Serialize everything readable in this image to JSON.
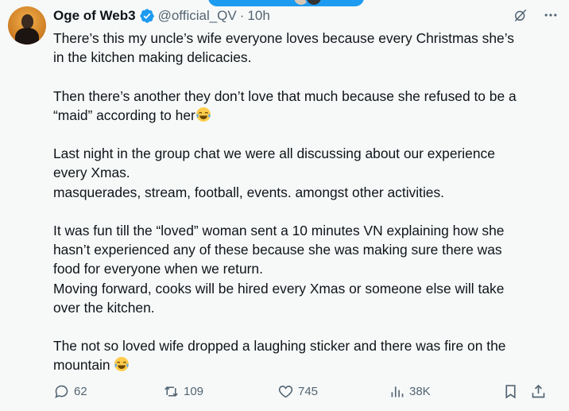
{
  "author": {
    "display_name": "Oge of Web3",
    "handle": "@official_QV",
    "separator": "·",
    "time": "10h"
  },
  "icons": {
    "verified": "verified-badge-icon",
    "grok": "grok-icon",
    "more": "more-horizontal-icon",
    "reply": "reply-icon",
    "retweet": "retweet-icon",
    "like": "like-icon",
    "views": "views-icon",
    "bookmark": "bookmark-icon",
    "share": "share-icon",
    "emoji": "face-with-tears-of-joy-emoji"
  },
  "colors": {
    "accent": "#1d9bf0",
    "text": "#0f1419",
    "secondary": "#536471",
    "background": "#f7f9f9"
  },
  "body": {
    "p1_l1": "There’s this my uncle’s wife everyone loves because every Christmas she’s",
    "p1_l2": "in the kitchen making delicacies.",
    "p2_l1": "Then there’s another they don’t love that much because she refused to be a",
    "p2_l2": "“maid” according to her",
    "p3_l1": "Last night in the group chat we were all discussing about our experience",
    "p3_l2": "every Xmas.",
    "p3_l3": "masquerades, stream, football, events. amongst other activities.",
    "p4_l1": "It was fun till the “loved” woman sent a 10 minutes VN explaining how she",
    "p4_l2": "hasn’t experienced any of these because she was making sure there was",
    "p4_l3": "food for everyone when we return.",
    "p4_l4": "Moving forward, cooks will be hired every Xmas or someone else will take",
    "p4_l5": "over the kitchen.",
    "p5_l1": "The not so loved wife dropped a laughing sticker and there was fire on the",
    "p5_l2": "mountain "
  },
  "metrics": {
    "replies": "62",
    "retweets": "109",
    "likes": "745",
    "views": "38K"
  }
}
